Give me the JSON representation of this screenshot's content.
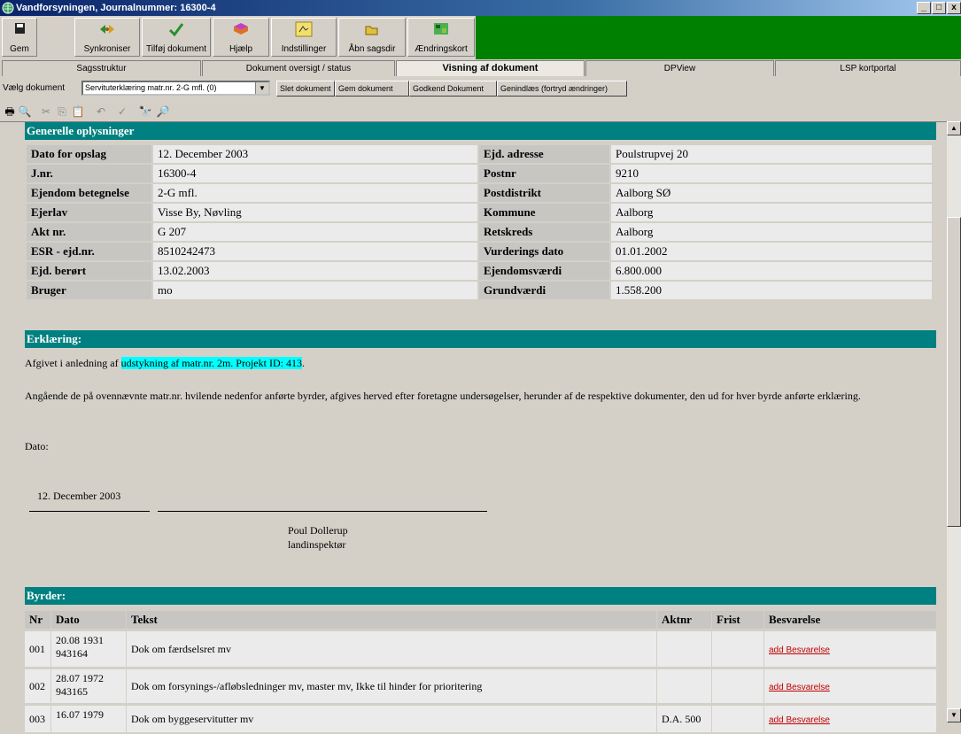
{
  "window": {
    "title": "Vandforsyningen, Journalnummer: 16300-4",
    "buttons": [
      "_",
      "□",
      "x"
    ]
  },
  "toolbar": {
    "buttons": [
      {
        "label": "Gem",
        "icon": "floppy-disk-icon"
      },
      {
        "label": "Synkroniser",
        "icon": "sync-icon"
      },
      {
        "label": "Tilføj dokument",
        "icon": "add-document-icon"
      },
      {
        "label": "Hjælp",
        "icon": "help-book-icon"
      },
      {
        "label": "Indstillinger",
        "icon": "settings-icon"
      },
      {
        "label": "Åbn sagsdir",
        "icon": "open-folder-icon"
      },
      {
        "label": "Ændringskort",
        "icon": "change-map-icon"
      }
    ]
  },
  "tabs": [
    {
      "label": "Sagsstruktur"
    },
    {
      "label": "Dokument oversigt / status"
    },
    {
      "label": "Visning af dokument",
      "active": true
    },
    {
      "label": "DPView"
    },
    {
      "label": "LSP kortportal"
    }
  ],
  "docbar": {
    "label": "Vælg dokument",
    "selected": "Servituterklæring matr.nr. 2-G mfl. (0)",
    "buttons": [
      "Slet dokument",
      "Gem dokument",
      "Godkend Dokument",
      "Genindlæs (fortryd ændringer)"
    ]
  },
  "general": {
    "title": "Generelle oplysninger",
    "left": [
      {
        "key": "Dato for opslag",
        "value": "12. December 2003"
      },
      {
        "key": "J.nr.",
        "value": "16300-4"
      },
      {
        "key": "Ejendom betegnelse",
        "value": "2-G mfl."
      },
      {
        "key": "Ejerlav",
        "value": "Visse By, Nøvling"
      },
      {
        "key": "Akt nr.",
        "value": "G 207"
      },
      {
        "key": "ESR - ejd.nr.",
        "value": "8510242473"
      },
      {
        "key": "Ejd. berørt",
        "value": "13.02.2003"
      },
      {
        "key": "Bruger",
        "value": "mo"
      }
    ],
    "right": [
      {
        "key": "Ejd. adresse",
        "value": "Poulstrupvej 20"
      },
      {
        "key": "Postnr",
        "value": "9210"
      },
      {
        "key": "Postdistrikt",
        "value": "Aalborg SØ"
      },
      {
        "key": "Kommune",
        "value": "Aalborg"
      },
      {
        "key": "Retskreds",
        "value": "Aalborg"
      },
      {
        "key": "Vurderings dato",
        "value": "01.01.2002"
      },
      {
        "key": "Ejendomsværdi",
        "value": "6.800.000"
      },
      {
        "key": "Grundværdi",
        "value": "1.558.200"
      }
    ]
  },
  "erklaering": {
    "title": "Erklæring:",
    "line1_prefix": "Afgivet i anledning af ",
    "line1_highlight": "udstykning af matr.nr. 2m. Projekt ID: 413",
    "line1_suffix": ".",
    "para": "Angående de på ovennævnte matr.nr. hvilende nedenfor anførte byrder, afgives herved efter foretagne undersøgelser, herunder af de respektive dokumenter, den ud for hver byrde anførte erklæring.",
    "dato_label": "Dato:",
    "date": "12. December 2003",
    "signer_name": "Poul Dollerup",
    "signer_title": "landinspektør"
  },
  "byrder": {
    "title": "Byrder:",
    "columns": [
      "Nr",
      "Dato",
      "Tekst",
      "Aktnr",
      "Frist",
      "Besvarelse"
    ],
    "rows": [
      {
        "nr": "001",
        "dato": "20.08 1931",
        "dato2": "943164",
        "tekst": "Dok om færdselsret mv",
        "aktnr": "",
        "frist": "",
        "besvarelse": "add Besvarelse"
      },
      {
        "nr": "002",
        "dato": "28.07 1972",
        "dato2": "943165",
        "tekst": "Dok om forsynings-/afløbsledninger mv, master mv, Ikke til hinder for prioritering",
        "aktnr": "",
        "frist": "",
        "besvarelse": "add Besvarelse"
      },
      {
        "nr": "003",
        "dato": "16.07 1979",
        "dato2": "",
        "tekst": "Dok om byggeservitutter mv",
        "aktnr": "D.A. 500",
        "frist": "",
        "besvarelse": "add Besvarelse"
      }
    ]
  }
}
